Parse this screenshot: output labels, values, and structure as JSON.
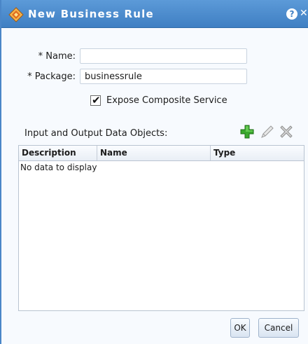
{
  "dialog": {
    "title": "New Business Rule",
    "help_icon": "help-icon",
    "close_icon": "close-icon",
    "title_icon": "business-rule-icon"
  },
  "form": {
    "name_label": "* Name:",
    "name_value": "",
    "package_label": "* Package:",
    "package_value": "businessrule",
    "expose_label": "Expose Composite Service",
    "expose_checked": true
  },
  "data_objects": {
    "label": "Input and Output Data Objects:",
    "toolbar": [
      "add-icon",
      "edit-icon",
      "delete-icon"
    ],
    "columns": [
      "Description",
      "Name",
      "Type"
    ],
    "empty_text": "No data to display"
  },
  "buttons": {
    "ok": "OK",
    "cancel": "Cancel"
  },
  "colors": {
    "titlebar": "#4a8ace",
    "add": "#3aa82c"
  }
}
